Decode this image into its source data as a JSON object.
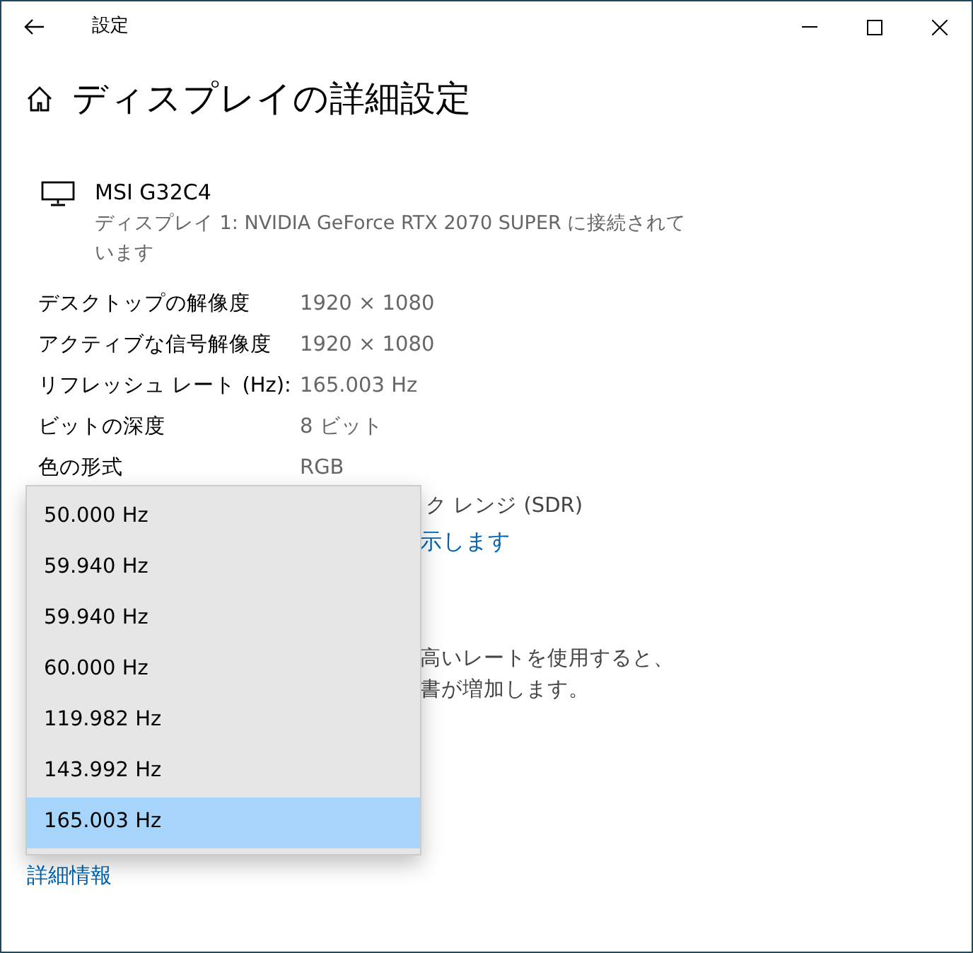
{
  "window": {
    "title": "設定"
  },
  "page_title": "ディスプレイの詳細設定",
  "display": {
    "name": "MSI G32C4",
    "description": "ディスプレイ 1: NVIDIA GeForce RTX 2070 SUPER に接続されています"
  },
  "info_rows": [
    {
      "label": "デスクトップの解像度",
      "value": "1920 × 1080"
    },
    {
      "label": "アクティブな信号解像度",
      "value": "1920 × 1080"
    },
    {
      "label": "リフレッシュ レート (Hz):",
      "value": "165.003 Hz"
    },
    {
      "label": "ビットの深度",
      "value": "8 ビット"
    },
    {
      "label": "色の形式",
      "value": "RGB"
    }
  ],
  "partial_texts": [
    {
      "kind": "text",
      "text": "ク レンジ (SDR)"
    },
    {
      "kind": "link",
      "text": "示します"
    },
    {
      "kind": "gap"
    },
    {
      "kind": "text",
      "text": "高いレートを使用すると、"
    },
    {
      "kind": "text",
      "text": "書が増加します。"
    }
  ],
  "refresh_dropdown": {
    "options": [
      {
        "label": "50.000 Hz",
        "selected": false
      },
      {
        "label": "59.940 Hz",
        "selected": false
      },
      {
        "label": "59.940 Hz",
        "selected": false
      },
      {
        "label": "60.000 Hz",
        "selected": false
      },
      {
        "label": "119.982 Hz",
        "selected": false
      },
      {
        "label": "143.992 Hz",
        "selected": false
      },
      {
        "label": "165.003 Hz",
        "selected": true
      }
    ]
  },
  "more_info_link": "詳細情報"
}
